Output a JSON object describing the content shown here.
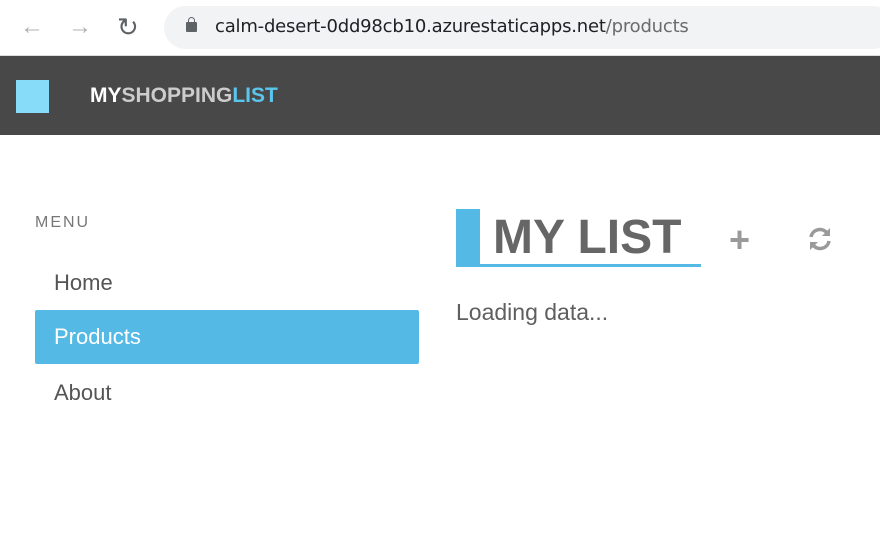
{
  "browser": {
    "url_host": "calm-desert-0dd98cb10.azurestaticapps.net",
    "url_path": "/products",
    "back_icon": "arrow-left-icon",
    "forward_icon": "arrow-right-icon",
    "reload_icon": "reload-icon"
  },
  "header": {
    "brand_my": "MY",
    "brand_shopping": "SHOPPING",
    "brand_list": "LIST",
    "accent": "#55b9e6"
  },
  "sidebar": {
    "label": "MENU",
    "items": [
      {
        "label": "Home"
      },
      {
        "label": "Products",
        "active": true
      },
      {
        "label": "About"
      }
    ]
  },
  "main": {
    "title": "MY LIST",
    "add_label": "+",
    "refresh_icon": "refresh-icon",
    "status": "Loading data..."
  }
}
